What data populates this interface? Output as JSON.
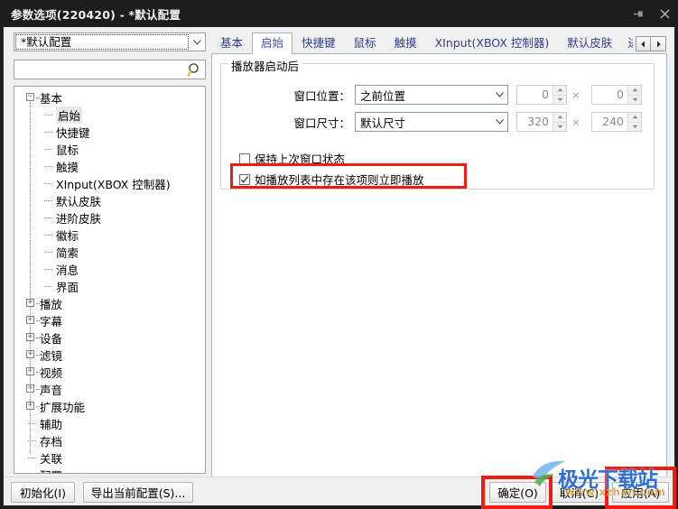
{
  "window": {
    "title": "参数选项(220420) - *默认配置",
    "pin_icon": "pin-icon",
    "close_icon": "close-icon"
  },
  "sidebar": {
    "profile_combo": {
      "value": "*默认配置",
      "arrow_icon": "chevron-down-icon"
    },
    "search": {
      "value": "",
      "placeholder": "",
      "icon": "search-icon"
    },
    "tree": [
      {
        "label": "基本",
        "level": 1,
        "expander": "−",
        "selected": false
      },
      {
        "label": "启始",
        "level": 2,
        "expander": "",
        "selected": true
      },
      {
        "label": "快捷键",
        "level": 2,
        "expander": "",
        "selected": false
      },
      {
        "label": "鼠标",
        "level": 2,
        "expander": "",
        "selected": false
      },
      {
        "label": "触摸",
        "level": 2,
        "expander": "",
        "selected": false
      },
      {
        "label": "XInput(XBOX 控制器)",
        "level": 2,
        "expander": "",
        "selected": false
      },
      {
        "label": "默认皮肤",
        "level": 2,
        "expander": "",
        "selected": false
      },
      {
        "label": "进阶皮肤",
        "level": 2,
        "expander": "",
        "selected": false
      },
      {
        "label": "徽标",
        "level": 2,
        "expander": "",
        "selected": false
      },
      {
        "label": "简索",
        "level": 2,
        "expander": "",
        "selected": false
      },
      {
        "label": "消息",
        "level": 2,
        "expander": "",
        "selected": false
      },
      {
        "label": "界面",
        "level": 2,
        "expander": "",
        "selected": false
      },
      {
        "label": "播放",
        "level": 1,
        "expander": "+",
        "selected": false
      },
      {
        "label": "字幕",
        "level": 1,
        "expander": "+",
        "selected": false
      },
      {
        "label": "设备",
        "level": 1,
        "expander": "+",
        "selected": false
      },
      {
        "label": "滤镜",
        "level": 1,
        "expander": "+",
        "selected": false
      },
      {
        "label": "视频",
        "level": 1,
        "expander": "+",
        "selected": false
      },
      {
        "label": "声音",
        "level": 1,
        "expander": "+",
        "selected": false
      },
      {
        "label": "扩展功能",
        "level": 1,
        "expander": "+",
        "selected": false
      },
      {
        "label": "辅助",
        "level": 1,
        "expander": "",
        "selected": false
      },
      {
        "label": "存档",
        "level": 1,
        "expander": "",
        "selected": false
      },
      {
        "label": "关联",
        "level": 1,
        "expander": "",
        "selected": false
      },
      {
        "label": "配置",
        "level": 1,
        "expander": "",
        "selected": false
      }
    ]
  },
  "tabs": {
    "items": [
      {
        "label": "基本",
        "active": false
      },
      {
        "label": "启始",
        "active": true
      },
      {
        "label": "快捷键",
        "active": false
      },
      {
        "label": "鼠标",
        "active": false
      },
      {
        "label": "触摸",
        "active": false
      },
      {
        "label": "XInput(XBOX 控制器)",
        "active": false
      },
      {
        "label": "默认皮肤",
        "active": false
      },
      {
        "label": "进",
        "active": false
      }
    ],
    "scroll_left_icon": "caret-left-icon",
    "scroll_right_icon": "caret-right-icon"
  },
  "panel": {
    "group_title": "播放器启动后",
    "rows": [
      {
        "label": "窗口位置：",
        "select_value": "之前位置",
        "x_value": "0",
        "y_value": "0",
        "separator": "×"
      },
      {
        "label": "窗口尺寸：",
        "select_value": "默认尺寸",
        "x_value": "320",
        "y_value": "240",
        "separator": "×"
      }
    ],
    "checkboxes": [
      {
        "label": "保持上次窗口状态",
        "checked": false,
        "highlighted": false
      },
      {
        "label": "如播放列表中存在该项则立即播放",
        "checked": true,
        "highlighted": true
      }
    ]
  },
  "footer": {
    "init_label": "初始化(I)",
    "export_label": "导出当前配置(S)...",
    "ok_label": "确定(O)",
    "cancel_label": "取消(C)",
    "apply_label": "应用(A)"
  },
  "watermark": {
    "text": "极光下载站",
    "sub": "www.xzhan.com"
  },
  "colors": {
    "highlight_red": "#ee1c15",
    "tab_text": "#2f3e8f",
    "watermark_blue": "#2f6fd0",
    "titlebar": "#1d1d1d"
  }
}
